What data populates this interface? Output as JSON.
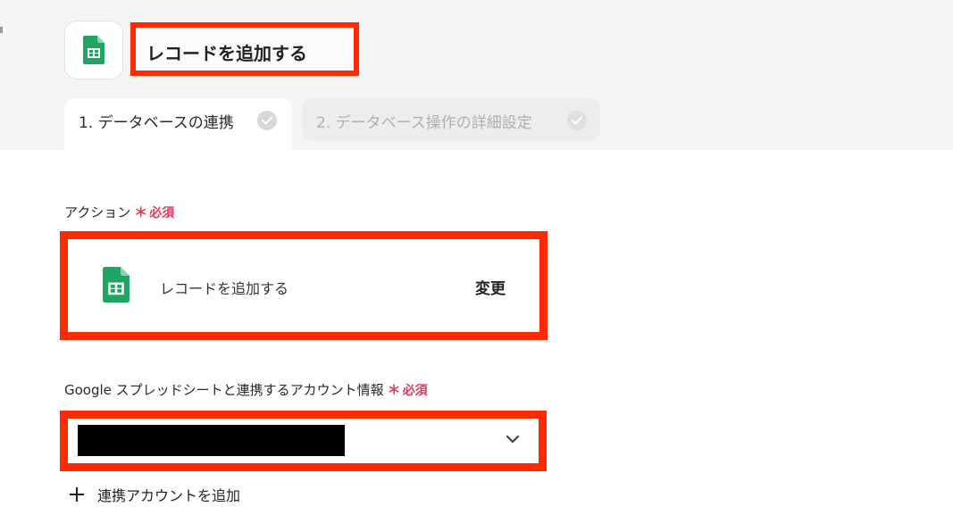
{
  "header": {
    "app_icon": "google-sheets-icon",
    "title": "レコードを追加する"
  },
  "steps": [
    {
      "label": "1. データベースの連携",
      "state": "active"
    },
    {
      "label": "2. データベース操作の詳細設定",
      "state": "inactive"
    }
  ],
  "action_field": {
    "label": "アクション",
    "required_mark": "＊",
    "required_text": "必須",
    "selected_icon": "google-sheets-icon",
    "selected_name": "レコードを追加する",
    "change_label": "変更"
  },
  "account_field": {
    "label": "Google スプレッドシートと連携するアカウント情報",
    "required_mark": "＊",
    "required_text": "必須",
    "selected_value_redacted": true
  },
  "add_account": {
    "label": "連携アカウントを追加"
  },
  "colors": {
    "highlight": "#ff2a00",
    "required": "#e8375a",
    "sheets_green": "#1fa463",
    "band": "#f5f5f5"
  }
}
